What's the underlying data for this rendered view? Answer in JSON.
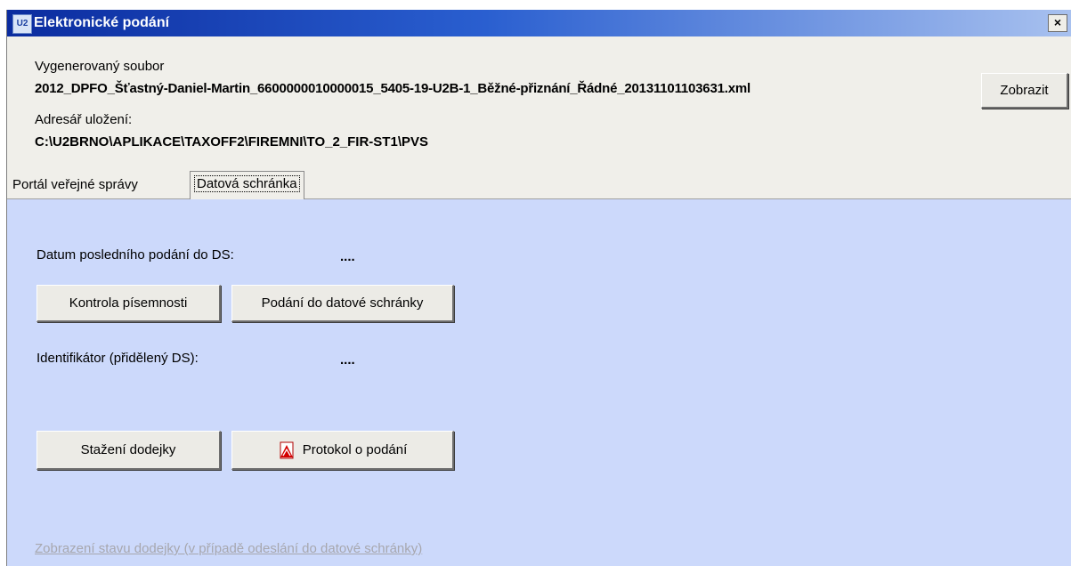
{
  "window": {
    "title": "Elektronické podání",
    "close_label": "×",
    "icon_text": "U2"
  },
  "file": {
    "generated_label": "Vygenerovaný soubor",
    "generated_name": "2012_DPFO_Šťastný-Daniel-Martin_6600000010000015_5405-19-U2B-1_Běžné-přiznání_Řádné_20131101103631.xml",
    "show_button": "Zobrazit",
    "dir_label": "Adresář uložení:",
    "dir_path": "C:\\U2BRNO\\APLIKACE\\TAXOFF2\\FIREMNI\\TO_2_FIR-ST1\\PVS"
  },
  "tabs": [
    {
      "label": "Portál veřejné správy"
    },
    {
      "label": "Datová schránka"
    }
  ],
  "panel": {
    "last_date_label": "Datum posledního podání do DS:",
    "last_date_value": "....",
    "check_button": "Kontrola písemnosti",
    "submit_button": "Podání do datové schránky",
    "identifier_label": "Identifikátor (přidělený DS):",
    "identifier_value": "....",
    "download_button": "Stažení dodejky",
    "protocol_button": "Protokol o podání",
    "status_link": "Zobrazení stavu dodejky (v případě odeslání do datové schránky)"
  },
  "colors": {
    "panel_bg": "#ccd9fb",
    "title_gradient_start": "#0b2c9f"
  }
}
